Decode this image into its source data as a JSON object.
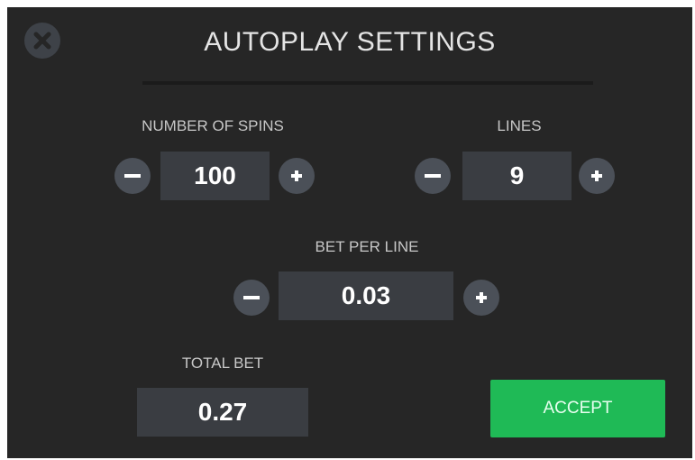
{
  "dialog": {
    "title": "AUTOPLAY SETTINGS"
  },
  "spins": {
    "label": "NUMBER OF SPINS",
    "value": "100"
  },
  "lines": {
    "label": "LINES",
    "value": "9"
  },
  "bet_per_line": {
    "label": "BET PER LINE",
    "value": "0.03"
  },
  "total_bet": {
    "label": "TOTAL BET",
    "value": "0.27"
  },
  "accept": {
    "label": "ACCEPT"
  },
  "icons": {
    "close": "close-icon",
    "minus": "minus-icon",
    "plus": "plus-icon"
  },
  "colors": {
    "background": "#262626",
    "value_box": "#3a3d42",
    "round_button": "#4b5058",
    "accept_button": "#1fba56",
    "title_text": "#e4e4e4"
  }
}
